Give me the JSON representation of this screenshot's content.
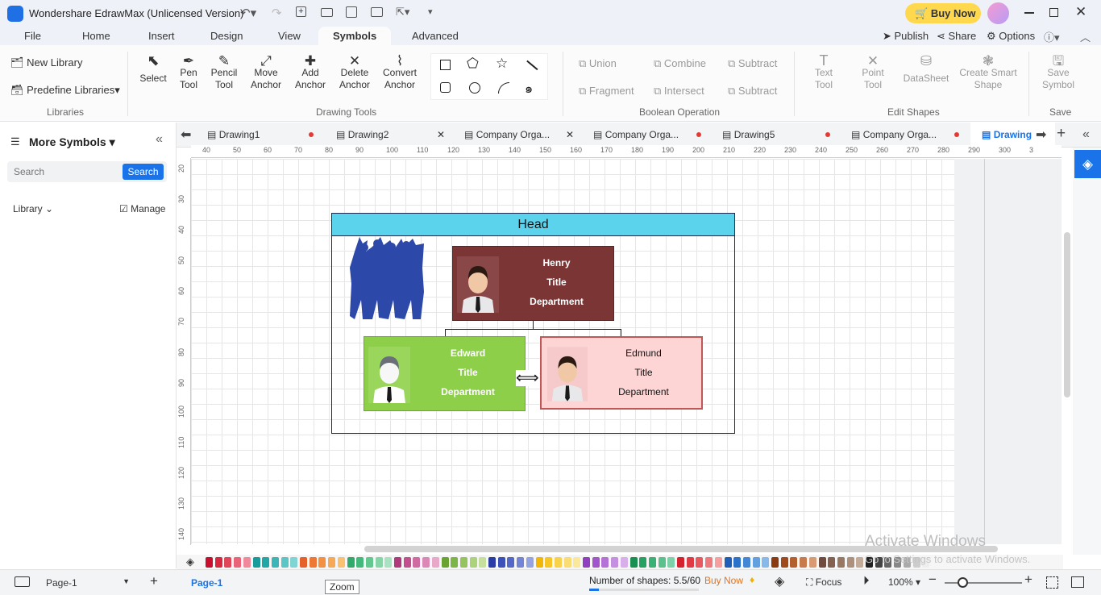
{
  "app": {
    "title": "Wondershare EdrawMax (Unlicensed Version)",
    "buy_now": "Buy Now"
  },
  "menu": {
    "items": [
      "File",
      "Home",
      "Insert",
      "Design",
      "View",
      "Symbols",
      "Advanced"
    ],
    "right": {
      "publish": "Publish",
      "share": "Share",
      "options": "Options"
    }
  },
  "ribbon": {
    "libraries": {
      "new_library": "New Library",
      "predefine": "Predefine Libraries",
      "group": "Libraries"
    },
    "drawing_tools": {
      "select": "Select",
      "pen": [
        "Pen",
        "Tool"
      ],
      "pencil": [
        "Pencil",
        "Tool"
      ],
      "move_anchor": [
        "Move",
        "Anchor"
      ],
      "add_anchor": [
        "Add",
        "Anchor"
      ],
      "delete_anchor": [
        "Delete",
        "Anchor"
      ],
      "convert_anchor": [
        "Convert",
        "Anchor"
      ],
      "group": "Drawing Tools"
    },
    "boolean": {
      "union": "Union",
      "combine": "Combine",
      "subtract1": "Subtract",
      "fragment": "Fragment",
      "intersect": "Intersect",
      "subtract2": "Subtract",
      "group": "Boolean Operation"
    },
    "edit_shapes": {
      "text_tool": [
        "Text",
        "Tool"
      ],
      "point_tool": [
        "Point",
        "Tool"
      ],
      "datasheet": "DataSheet",
      "smart_shape": [
        "Create Smart",
        "Shape"
      ],
      "group": "Edit Shapes"
    },
    "save": {
      "save_symbol": [
        "Save",
        "Symbol"
      ],
      "group": "Save"
    }
  },
  "left_panel": {
    "title": "More Symbols",
    "search_placeholder": "Search",
    "search_button": "Search",
    "library": "Library",
    "manage": "Manage"
  },
  "doc_tabs": [
    {
      "label": "Drawing1",
      "state": "dot"
    },
    {
      "label": "Drawing2",
      "state": "close"
    },
    {
      "label": "Company Orga...",
      "state": "close"
    },
    {
      "label": "Company Orga...",
      "state": "dot"
    },
    {
      "label": "Drawing5",
      "state": "dot"
    },
    {
      "label": "Company Orga...",
      "state": "dot"
    },
    {
      "label": "Drawing",
      "state": "active"
    }
  ],
  "ruler_h": [
    "40",
    "50",
    "60",
    "70",
    "80",
    "90",
    "100",
    "110",
    "120",
    "130",
    "140",
    "150",
    "160",
    "170",
    "180",
    "190",
    "200",
    "210",
    "220",
    "230",
    "240",
    "250",
    "260",
    "270",
    "280",
    "290",
    "300",
    "3"
  ],
  "ruler_v": [
    "20",
    "30",
    "40",
    "50",
    "60",
    "70",
    "80",
    "90",
    "100",
    "110",
    "120",
    "130",
    "140"
  ],
  "diagram": {
    "head": "Head",
    "henry": {
      "name": "Henry",
      "title": "Title",
      "dept": "Department",
      "fill": "#7b3535"
    },
    "edward": {
      "name": "Edward",
      "title": "Title",
      "dept": "Department",
      "fill": "#8ecf4a"
    },
    "edmund": {
      "name": "Edmund",
      "title": "Title",
      "dept": "Department",
      "fill": "#fdd5d5"
    },
    "head_fill": "#5cd3ec"
  },
  "status": {
    "page_selector": "Page-1",
    "page_tab": "Page-1",
    "shapes": "Number of shapes: 5.5/60",
    "buy_now": "Buy Now",
    "focus": "Focus",
    "zoom": "100%",
    "tooltip": "Zoom"
  },
  "watermark": {
    "line1": "Activate Windows",
    "line2": "Go to Settings to activate Windows."
  },
  "palette": [
    "#c8102e",
    "#d8283f",
    "#e0455a",
    "#e96478",
    "#f08a9b",
    "#179b9b",
    "#22a7a7",
    "#3bb6b6",
    "#5cc5c5",
    "#80d4d4",
    "#e6612a",
    "#ee7733",
    "#f39042",
    "#f6a957",
    "#f9c273",
    "#2faa6a",
    "#44b97c",
    "#63c790",
    "#86d5a8",
    "#a8e2c0",
    "#b03a7c",
    "#c2508f",
    "#d06aa2",
    "#dc88b6",
    "#e8a8ca",
    "#6aa331",
    "#7eb547",
    "#95c45f",
    "#acd27c",
    "#c4e09c",
    "#2a3ca6",
    "#3b50b8",
    "#5469c7",
    "#7385d4",
    "#95a4e0",
    "#f2b705",
    "#f6c526",
    "#f8d24b",
    "#fadd72",
    "#fce89b",
    "#8f3fbf",
    "#a256cc",
    "#b472d6",
    "#c690e0",
    "#d8afea",
    "#1a8f52",
    "#27a162",
    "#3cb176",
    "#5ac18d",
    "#7dd1a8",
    "#d6222f",
    "#e03b44",
    "#e8585e",
    "#ef7a7d",
    "#f59f9f",
    "#1f5fb8",
    "#2d72c9",
    "#4487d6",
    "#62a0e0",
    "#87b9ea",
    "#8a3b12",
    "#a04a1c",
    "#b45f2e",
    "#c77a4b",
    "#d89a72",
    "#6f4b3e",
    "#83604f",
    "#987763",
    "#ad917c",
    "#c3ab99",
    "#222222",
    "#444444",
    "#666666",
    "#888888",
    "#aaaaaa",
    "#cccccc",
    "#eeeeee"
  ]
}
